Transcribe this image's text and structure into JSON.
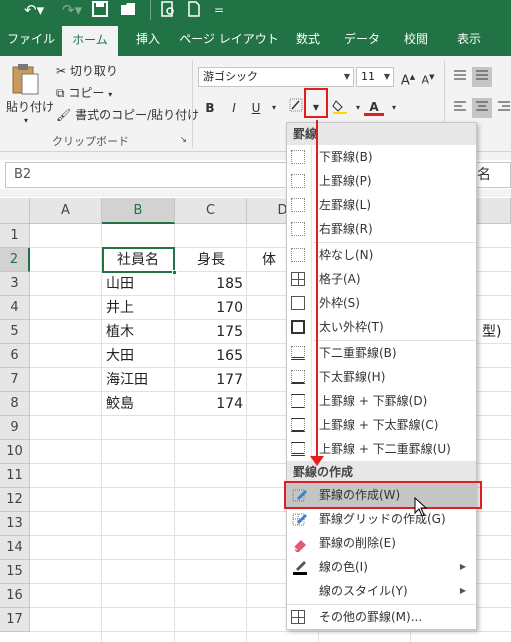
{
  "quick_access": {
    "undo_icon": "undo-icon",
    "redo_icon": "redo-icon",
    "save_icon": "save-icon",
    "open_icon": "folder-icon",
    "preview_icon": "print-preview-icon",
    "new_icon": "new-document-icon",
    "more": "="
  },
  "tabs": [
    "ファイル",
    "ホーム",
    "挿入",
    "ページ レイアウト",
    "数式",
    "データ",
    "校閲",
    "表示"
  ],
  "active_tab": "ホーム",
  "ribbon": {
    "paste_label": "貼り付け",
    "cut_label": "切り取り",
    "copy_label": "コピー",
    "format_painter_label": "書式のコピー/貼り付け",
    "clipboard_group": "クリップボード",
    "font_name": "游ゴシック",
    "font_size": "11",
    "grow_font": "A",
    "shrink_font": "A",
    "bold": "B",
    "italic": "I",
    "underline": "U",
    "font_color_label": "A"
  },
  "name_box": "B2",
  "formula_partial": "名",
  "columns": [
    "A",
    "B",
    "C",
    "D"
  ],
  "rows": [
    "1",
    "2",
    "3",
    "4",
    "5",
    "6",
    "7",
    "8",
    "9",
    "10",
    "11",
    "12",
    "13",
    "14",
    "15",
    "16",
    "17"
  ],
  "cells": {
    "header_name": "社員名",
    "header_height": "身長",
    "header_weight_partial": "体",
    "partial_e5": "型)",
    "names": [
      "山田",
      "井上",
      "植木",
      "大田",
      "海江田",
      "鮫島"
    ],
    "heights": [
      "185",
      "170",
      "175",
      "165",
      "177",
      "174"
    ]
  },
  "menu": {
    "section1": "罫線",
    "items1": [
      "下罫線(B)",
      "上罫線(P)",
      "左罫線(L)",
      "右罫線(R)",
      "枠なし(N)",
      "格子(A)",
      "外枠(S)",
      "太い外枠(T)",
      "下二重罫線(B)",
      "下太罫線(H)",
      "上罫線 + 下罫線(D)",
      "上罫線 + 下太罫線(C)",
      "上罫線 + 下二重罫線(U)"
    ],
    "section2": "罫線の作成",
    "items2": [
      "罫線の作成(W)",
      "罫線グリッドの作成(G)",
      "罫線の削除(E)",
      "線の色(I)",
      "線のスタイル(Y)",
      "その他の罫線(M)..."
    ]
  },
  "colors": {
    "excel_green": "#217346",
    "annotation_red": "#e31e1e"
  }
}
